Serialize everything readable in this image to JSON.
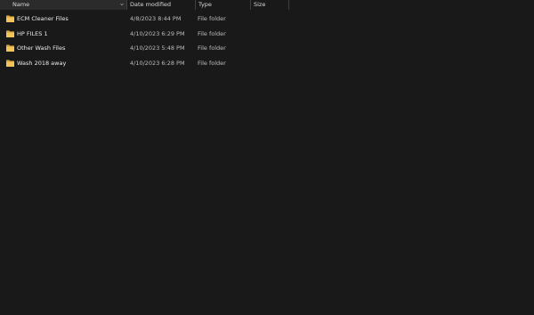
{
  "columns": {
    "name": "Name",
    "date_modified": "Date modified",
    "type": "Type",
    "size": "Size"
  },
  "folder_icon": "folder-icon",
  "folder_color": "#e8b64a",
  "files": [
    {
      "name": "ECM Cleaner Files",
      "date": "4/8/2023 8:44 PM",
      "type": "File folder",
      "size": ""
    },
    {
      "name": "HP FILES 1",
      "date": "4/10/2023 6:29 PM",
      "type": "File folder",
      "size": ""
    },
    {
      "name": "Other Wash Files",
      "date": "4/10/2023 5:48 PM",
      "type": "File folder",
      "size": ""
    },
    {
      "name": "Wash 2018 away",
      "date": "4/10/2023 6:28 PM",
      "type": "File folder",
      "size": ""
    }
  ]
}
